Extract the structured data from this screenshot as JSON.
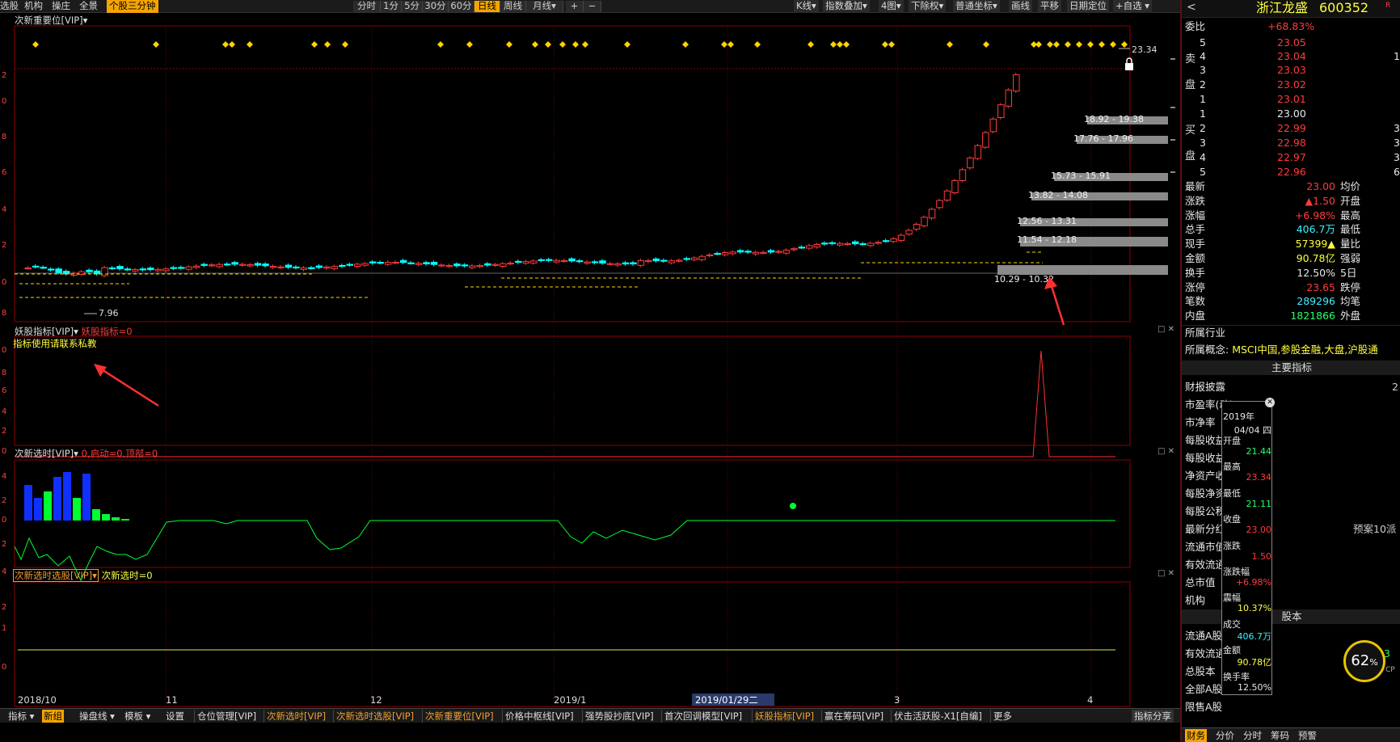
{
  "toolbar": {
    "left_items": [
      "选股",
      "机构",
      "操庄",
      "全景"
    ],
    "active_left": "个股三分钟",
    "periods": [
      "分时",
      "1分",
      "5分",
      "30分",
      "60分",
      "日线",
      "周线",
      "月线▾"
    ],
    "active_period": "日线",
    "zoom_in": "+",
    "zoom_out": "−",
    "right_items": [
      "K线▾",
      "指数叠加▾",
      "4图▾",
      "下除权▾",
      "普通坐标▾",
      "画线",
      "平移",
      "日期定位",
      "+自选 ▾"
    ]
  },
  "panel1": {
    "title": "次新重要位[VIP]▾",
    "high_label": "23.34",
    "low_label": "7.96",
    "levels": [
      "18.92 - 19.38",
      "17.76 - 17.96",
      "15.73 - 15.91",
      "13.82 - 14.08",
      "12.56 - 13.31",
      "11.54 - 12.18",
      "10.29 - 10.32"
    ]
  },
  "panel2": {
    "title": "妖股指标[VIP]▾",
    "value_text": "妖股指标=0",
    "note": "指标使用请联系私教"
  },
  "panel3": {
    "title": "次新选时[VIP]▾",
    "value_text": "0,启动=0,顶部=0"
  },
  "panel4": {
    "title": "次新选时选股[VIP]▾",
    "value_text": "次新选时=0"
  },
  "axis_dates": [
    "2018/10",
    "11",
    "12",
    "2019/1",
    "2019/01/29二",
    "3",
    "4"
  ],
  "bottom_tabs": [
    "指标 ▾",
    "新组",
    "操盘线 ▾",
    "模板 ▾",
    "设置",
    "仓位管理[VIP]",
    "次新选时[VIP]",
    "次新选时选股[VIP]",
    "次新重要位[VIP]",
    "价格中枢线[VIP]",
    "强势股抄底[VIP]",
    "首次回调模型[VIP]",
    "妖股指标[VIP]",
    "赢在筹码[VIP]",
    "伏击活跃股-X1[自编]",
    "更多"
  ],
  "bottom_right": "指标分享",
  "quote": {
    "stock_name": "浙江龙盛",
    "stock_code": "600352",
    "badge": "R",
    "weibi_label": "委比",
    "weibi_value": "+68.83%",
    "sell_label": [
      "卖",
      "盘"
    ],
    "buy_label": [
      "买",
      "盘"
    ],
    "asks": [
      {
        "n": "5",
        "p": "23.05"
      },
      {
        "n": "4",
        "p": "23.04"
      },
      {
        "n": "3",
        "p": "23.03"
      },
      {
        "n": "2",
        "p": "23.02"
      },
      {
        "n": "1",
        "p": "23.01"
      }
    ],
    "bids": [
      {
        "n": "1",
        "p": "23.00"
      },
      {
        "n": "2",
        "p": "22.99"
      },
      {
        "n": "3",
        "p": "22.98"
      },
      {
        "n": "4",
        "p": "22.97"
      },
      {
        "n": "5",
        "p": "22.96"
      }
    ],
    "ask_vols": [
      "",
      "1",
      "",
      "",
      ""
    ],
    "bid_vols": [
      "",
      "3",
      "3",
      "3",
      "6"
    ],
    "stats": [
      {
        "l": "最新",
        "v": "23.00",
        "r": "均价"
      },
      {
        "l": "涨跌",
        "v": "▲1.50",
        "r": "开盘"
      },
      {
        "l": "涨幅",
        "v": "+6.98%",
        "r": "最高"
      },
      {
        "l": "总手",
        "v": "406.7万",
        "r": "最低"
      },
      {
        "l": "现手",
        "v": "57399▲",
        "r": "量比"
      },
      {
        "l": "金额",
        "v": "90.78亿",
        "r": "强弱"
      },
      {
        "l": "换手",
        "v": "12.50%",
        "r": "5日"
      },
      {
        "l": "涨停",
        "v": "23.65",
        "r": "跌停"
      },
      {
        "l": "笔数",
        "v": "289296",
        "r": "均笔"
      },
      {
        "l": "内盘",
        "v": "1821866",
        "r": "外盘"
      }
    ],
    "industry_label": "所属行业",
    "concept_label": "所属概念:",
    "concept_value": "MSCI中国,参股金融,大盘,沪股通",
    "main_header": "主要指标",
    "main_items": [
      "财报披露",
      "市盈率(动)",
      "市净率",
      "每股收益",
      "每股收益",
      "净资产收益",
      "每股净资产",
      "每股公积金",
      "最新分红",
      "流通市值",
      "有效流通",
      "总市值",
      "机构"
    ],
    "fin_right_value": "2",
    "dividend_value": "预案10派",
    "share_header": "股本",
    "share_items": [
      "流通A股",
      "有效流通",
      "总股本",
      "全部A股",
      "限售A股"
    ],
    "share_right_value": "3",
    "gauge_value": "62",
    "gauge_unit": "%",
    "gauge_side": "CP",
    "bottom_tabs": [
      "财务",
      "分价",
      "分时",
      "筹码",
      "预警"
    ]
  },
  "tooltip": {
    "year": "2019年",
    "date": "04/04 四",
    "rows": [
      {
        "l": "开盘",
        "v": "21.44",
        "c": "grn"
      },
      {
        "l": "最高",
        "v": "23.34",
        "c": "red"
      },
      {
        "l": "最低",
        "v": "21.11",
        "c": "grn"
      },
      {
        "l": "收盘",
        "v": "23.00",
        "c": "red"
      },
      {
        "l": "涨跌",
        "v": "1.50",
        "c": "red"
      },
      {
        "l": "涨跌幅",
        "v": "+6.98%",
        "c": "red"
      },
      {
        "l": "震幅",
        "v": "10.37%",
        "c": "yel"
      },
      {
        "l": "成交",
        "v": "406.7万",
        "c": "cyan"
      },
      {
        "l": "金额",
        "v": "90.78亿",
        "c": "yel"
      },
      {
        "l": "换手率",
        "v": "12.50%",
        "c": "wht"
      }
    ]
  }
}
